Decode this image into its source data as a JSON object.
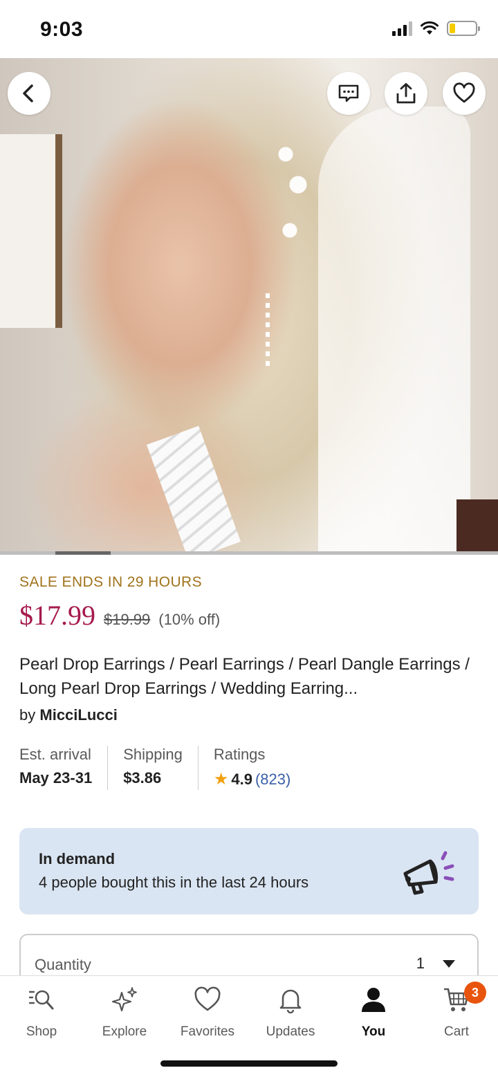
{
  "status": {
    "time": "9:03"
  },
  "product": {
    "sale_banner": "SALE ENDS IN 29 HOURS",
    "price": "$17.99",
    "original_price": "$19.99",
    "discount": "(10% off)",
    "title": "Pearl Drop Earrings / Pearl Earrings / Pearl Dangle Earrings / Long Pearl Drop Earrings / Wedding Earring...",
    "seller_prefix": "by",
    "seller": "MicciLucci"
  },
  "stats": {
    "arrival_label": "Est. arrival",
    "arrival_value": "May 23-31",
    "shipping_label": "Shipping",
    "shipping_value": "$3.86",
    "ratings_label": "Ratings",
    "rating_value": "4.9",
    "rating_count": "(823)"
  },
  "demand": {
    "title": "In demand",
    "text": "4 people bought this in the last 24 hours"
  },
  "quantity": {
    "label": "Quantity",
    "value": "1"
  },
  "nav": {
    "items": [
      {
        "label": "Shop",
        "icon": "shop-search-icon"
      },
      {
        "label": "Explore",
        "icon": "sparkle-icon"
      },
      {
        "label": "Favorites",
        "icon": "heart-icon"
      },
      {
        "label": "Updates",
        "icon": "bell-icon"
      },
      {
        "label": "You",
        "icon": "person-icon"
      },
      {
        "label": "Cart",
        "icon": "cart-icon"
      }
    ],
    "active": "You",
    "cart_count": "3"
  },
  "colors": {
    "price": "#a61a4d",
    "sale": "#a0731c",
    "demand_bg": "#dae5f3",
    "rating_link": "#3a5fa8",
    "cart_badge": "#e8540e"
  },
  "carousel": {
    "active_index": 2
  }
}
